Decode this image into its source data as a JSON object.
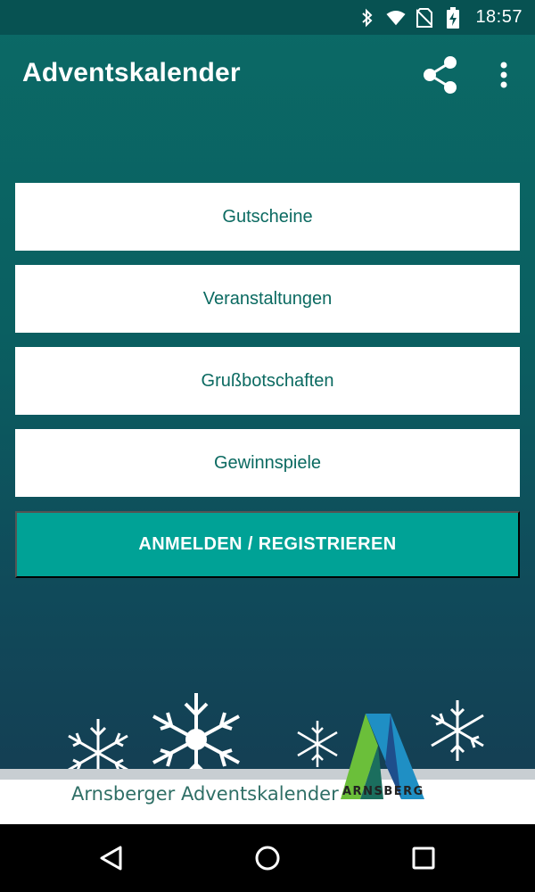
{
  "status_bar": {
    "time": "18:57",
    "icons": [
      "bluetooth-icon",
      "wifi-icon",
      "no-sim-icon",
      "battery-charging-icon"
    ]
  },
  "app_bar": {
    "title": "Adventskalender",
    "actions": [
      "share-icon",
      "more-vert-icon"
    ]
  },
  "menu": {
    "items": [
      {
        "label": "Gutscheine"
      },
      {
        "label": "Veranstaltungen"
      },
      {
        "label": "Grußbotschaften"
      },
      {
        "label": "Gewinnspiele"
      }
    ],
    "login_label": "ANMELDEN / REGISTRIEREN"
  },
  "footer": {
    "banner_text": "Arnsberger Adventskalender",
    "logo_text": "ARNSBERG"
  },
  "nav_bar": {
    "buttons": [
      "back-icon",
      "home-icon",
      "recents-icon"
    ]
  },
  "colors": {
    "primary_dark": "#075252",
    "primary": "#0b6a66",
    "accent": "#00a296",
    "menu_text": "#0b6a61"
  }
}
